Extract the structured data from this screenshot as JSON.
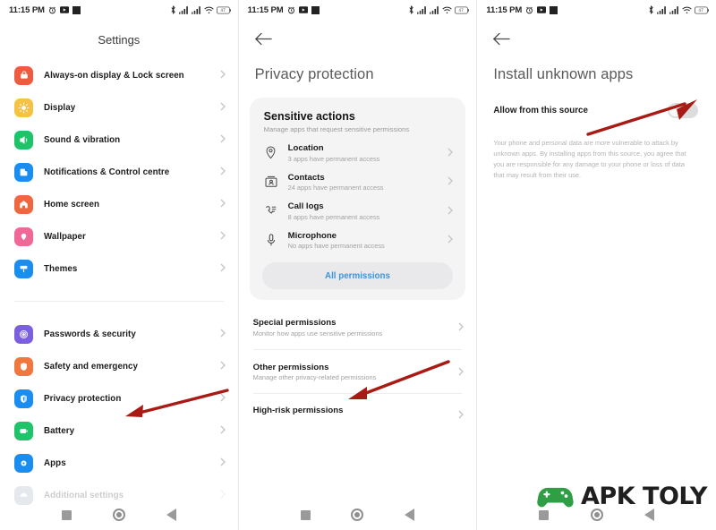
{
  "status_bar": {
    "time": "11:15 PM",
    "left_icons": [
      "alarm-icon",
      "screen-record-icon",
      "battery-saver-icon"
    ],
    "right_icons": [
      "bluetooth-icon",
      "signal-1-icon",
      "signal-2-icon",
      "wifi-icon",
      "battery-icon"
    ],
    "battery_label": "47"
  },
  "panel1": {
    "title": "Settings",
    "items_group1": [
      {
        "label": "Always-on display & Lock screen",
        "icon": "lock-icon",
        "color": "#f05a3e"
      },
      {
        "label": "Display",
        "icon": "brightness-icon",
        "color": "#f6c244"
      },
      {
        "label": "Sound & vibration",
        "icon": "speaker-icon",
        "color": "#1ec36a"
      },
      {
        "label": "Notifications & Control centre",
        "icon": "notification-icon",
        "color": "#1a8df0"
      },
      {
        "label": "Home screen",
        "icon": "home-icon",
        "color": "#f0663e"
      },
      {
        "label": "Wallpaper",
        "icon": "wallpaper-icon",
        "color": "#f06898"
      },
      {
        "label": "Themes",
        "icon": "themes-icon",
        "color": "#1a8df0"
      }
    ],
    "items_group2": [
      {
        "label": "Passwords & security",
        "icon": "fingerprint-icon",
        "color": "#7b5fe0"
      },
      {
        "label": "Safety and emergency",
        "icon": "safety-icon",
        "color": "#f0783e"
      },
      {
        "label": "Privacy protection",
        "icon": "privacy-shield-icon",
        "color": "#1a8df0"
      },
      {
        "label": "Battery",
        "icon": "battery-icon",
        "color": "#1ec36a"
      },
      {
        "label": "Apps",
        "icon": "apps-icon",
        "color": "#1a8df0"
      },
      {
        "label": "Additional settings",
        "icon": "additional-settings-icon",
        "color": "#8d99ae"
      }
    ]
  },
  "panel2": {
    "back_icon": "arrow-left-icon",
    "title": "Privacy protection",
    "card": {
      "heading": "Sensitive actions",
      "subheading": "Manage apps that request sensitive permissions",
      "rows": [
        {
          "title": "Location",
          "sub": "3 apps have permanent access",
          "icon": "location-pin-icon"
        },
        {
          "title": "Contacts",
          "sub": "24 apps have permanent access",
          "icon": "contacts-icon"
        },
        {
          "title": "Call logs",
          "sub": "8 apps have permanent access",
          "icon": "call-log-icon"
        },
        {
          "title": "Microphone",
          "sub": "No apps have permanent access",
          "icon": "microphone-icon"
        }
      ],
      "button_label": "All permissions",
      "button_color": "#3e93dd"
    },
    "permissions": [
      {
        "title": "Special permissions",
        "sub": "Monitor how apps use sensitive permissions"
      },
      {
        "title": "Other permissions",
        "sub": "Manage other privacy-related permissions"
      },
      {
        "title": "High-risk permissions",
        "sub": ""
      }
    ]
  },
  "panel3": {
    "back_icon": "arrow-left-icon",
    "title": "Install unknown apps",
    "toggle_label": "Allow from this source",
    "toggle_state": "off",
    "description": "Your phone and personal data are more vulnerable to attack by unknown apps. By installing apps from this source, you agree that you are responsible for any damage to your phone or loss of data that may result from their use."
  },
  "watermark": {
    "text": "APK TOLY",
    "icon": "gamepad-icon",
    "color": "#2f9e44"
  },
  "nav_bar": {
    "recents_icon": "square-icon",
    "home_icon": "circle-icon",
    "back_icon": "triangle-back-icon"
  },
  "annotations": {
    "arrow_color": "#a81b14",
    "arrow1_target": "Privacy protection",
    "arrow2_target": "Special permissions",
    "arrow3_target": "Allow from this source toggle"
  }
}
